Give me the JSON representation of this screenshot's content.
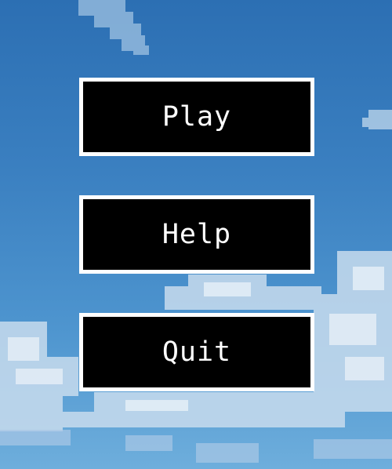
{
  "menu": {
    "buttons": [
      {
        "id": "play",
        "label": "Play"
      },
      {
        "id": "help",
        "label": "Help"
      },
      {
        "id": "quit",
        "label": "Quit"
      }
    ]
  },
  "colors": {
    "sky_top": "#2c6fb3",
    "sky_bottom": "#6eaedc",
    "cloud": "#dfeaf4",
    "button_bg": "#000000",
    "button_border": "#ffffff",
    "button_text": "#ffffff"
  }
}
